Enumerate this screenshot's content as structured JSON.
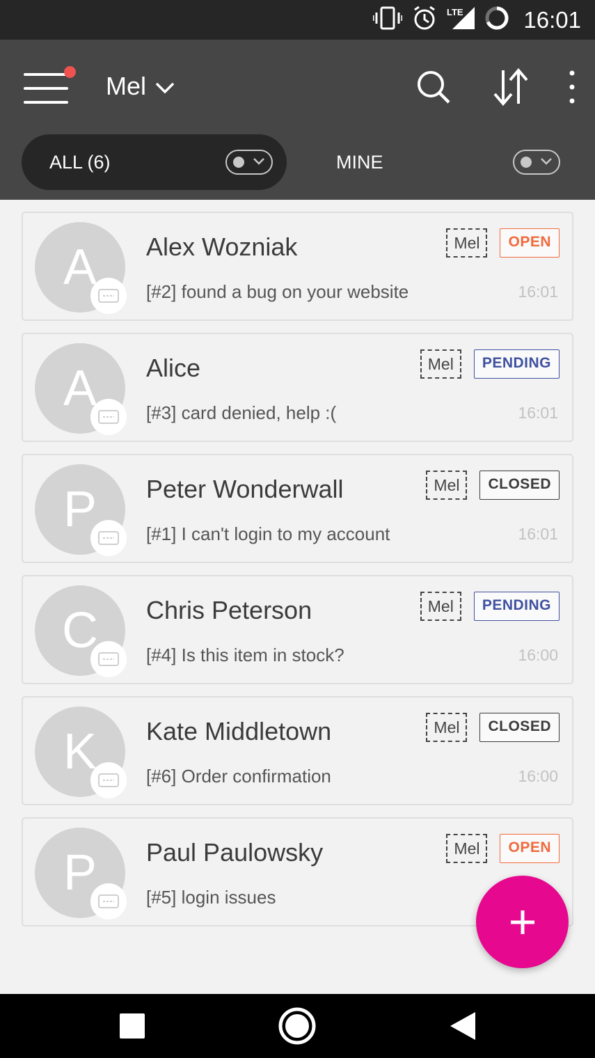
{
  "status_bar": {
    "time": "16:01",
    "icons": [
      "vibrate-icon",
      "alarm-icon",
      "lte-signal-icon",
      "battery-icon"
    ]
  },
  "app_bar": {
    "agent_name": "Mel",
    "actions": [
      "search-icon",
      "sort-icon",
      "more-options-icon"
    ],
    "notification_dot_color": "#ef5350"
  },
  "filters": {
    "all_label": "ALL (6)",
    "mine_label": "MINE"
  },
  "tickets": [
    {
      "initial": "A",
      "name": "Alex Wozniak",
      "subject": "[#2] found a bug on your website",
      "time": "16:01",
      "assignee": "Mel",
      "status": "OPEN"
    },
    {
      "initial": "A",
      "name": "Alice",
      "subject": "[#3] card denied, help :(",
      "time": "16:01",
      "assignee": "Mel",
      "status": "PENDING"
    },
    {
      "initial": "P",
      "name": "Peter Wonderwall",
      "subject": "[#1] I can't login to my account",
      "time": "16:01",
      "assignee": "Mel",
      "status": "CLOSED"
    },
    {
      "initial": "C",
      "name": "Chris Peterson",
      "subject": "[#4] Is this item in stock?",
      "time": "16:00",
      "assignee": "Mel",
      "status": "PENDING"
    },
    {
      "initial": "K",
      "name": "Kate Middletown",
      "subject": "[#6] Order confirmation",
      "time": "16:00",
      "assignee": "Mel",
      "status": "CLOSED"
    },
    {
      "initial": "P",
      "name": "Paul Paulowsky",
      "subject": "[#5] login issues",
      "time": "",
      "assignee": "Mel",
      "status": "OPEN"
    }
  ],
  "status_colors": {
    "OPEN": "#f06a3d",
    "PENDING": "#3f51a0",
    "CLOSED": "#3b3b3b"
  },
  "fab": {
    "icon": "plus-icon",
    "color": "#e6088f"
  },
  "nav_bar": {
    "buttons": [
      "recents-square-icon",
      "home-circle-icon",
      "back-triangle-icon"
    ]
  }
}
